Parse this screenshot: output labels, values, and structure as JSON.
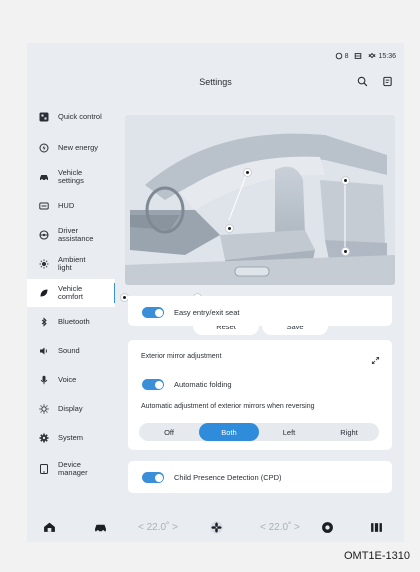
{
  "status_bar": {
    "item1": "8",
    "time": "15:36"
  },
  "header": {
    "title": "Settings",
    "search_icon": "search-icon",
    "notes_icon": "notes-icon"
  },
  "sidebar": {
    "items": [
      {
        "label": "Quick control",
        "icon": "quick-control-icon"
      },
      {
        "label": "New energy",
        "icon": "energy-icon"
      },
      {
        "label": "Vehicle settings",
        "icon": "car-icon"
      },
      {
        "label": "HUD",
        "icon": "hud-icon"
      },
      {
        "label": "Driver assistance",
        "icon": "steering-wheel-icon"
      },
      {
        "label": "Ambient light",
        "icon": "ambient-light-icon"
      },
      {
        "label": "Vehicle comfort",
        "icon": "comfort-icon",
        "active": true
      },
      {
        "label": "Bluetooth",
        "icon": "bluetooth-icon"
      },
      {
        "label": "Sound",
        "icon": "speaker-icon"
      },
      {
        "label": "Voice",
        "icon": "microphone-icon"
      },
      {
        "label": "Display",
        "icon": "brightness-icon"
      },
      {
        "label": "System",
        "icon": "gear-icon"
      },
      {
        "label": "Device manager",
        "icon": "tablet-icon"
      }
    ]
  },
  "seat_panel": {
    "reset_label": "Reset",
    "save_label": "Save"
  },
  "cards": {
    "easy_entry": {
      "label": "Easy entry/exit seat",
      "enabled": true
    },
    "mirror": {
      "title": "Exterior mirror adjustment",
      "folding_label": "Automatic folding",
      "folding_enabled": true,
      "reversing_label": "Automatic adjustment of exterior mirrors when reversing",
      "options": [
        "Off",
        "Both",
        "Left",
        "Right"
      ],
      "selected": "Both"
    },
    "cpd": {
      "label": "Child Presence Detection (CPD)",
      "enabled": true
    }
  },
  "bottom_bar": {
    "left_temp": "< 22.0˚ >",
    "right_temp": "< 22.0˚ >"
  },
  "caption": "OMT1E-1310",
  "colors": {
    "accent": "#2f8cdb",
    "screen_bg": "#e9edf1",
    "card_bg": "#ffffff"
  }
}
